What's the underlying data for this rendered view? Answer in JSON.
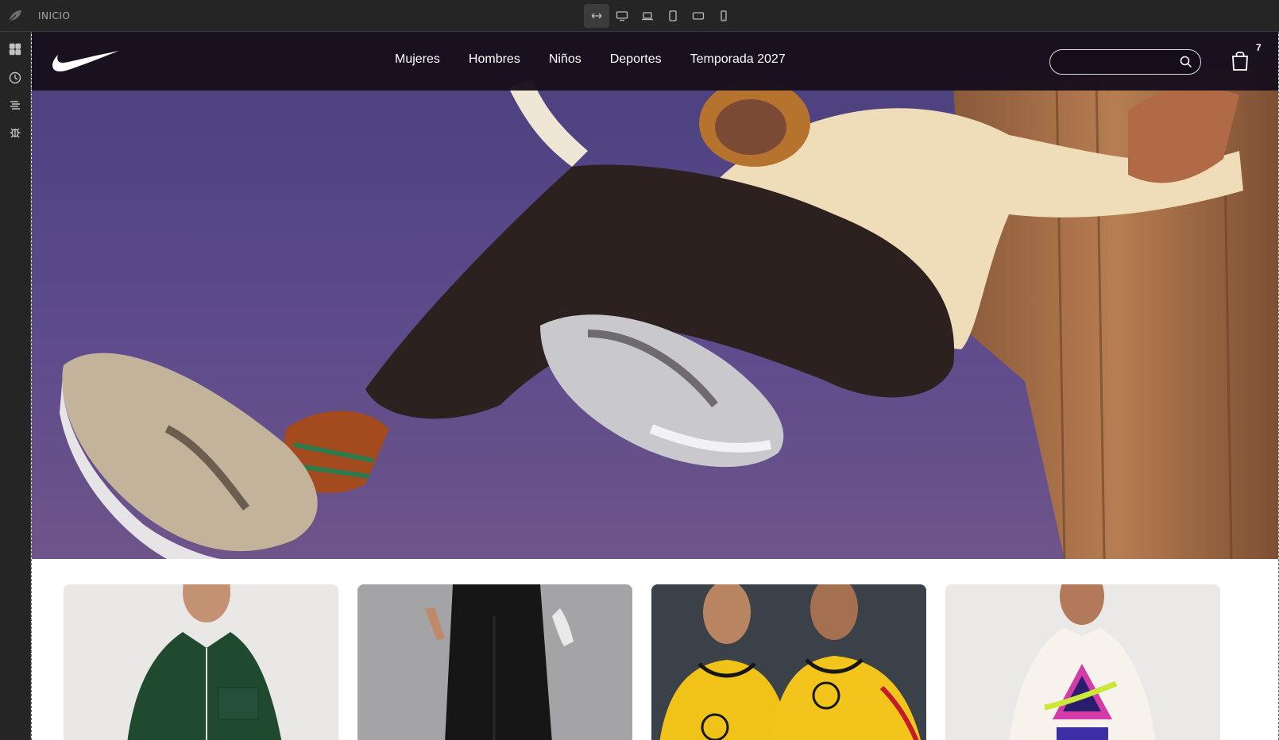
{
  "editor": {
    "breadcrumb": "INICIO",
    "devices": [
      "fit-width-icon",
      "desktop-icon",
      "laptop-icon",
      "tablet-icon",
      "tablet-landscape-icon",
      "mobile-icon"
    ],
    "sidebar": [
      "grid-icon",
      "history-icon",
      "layers-icon",
      "bug-icon"
    ]
  },
  "site": {
    "logo": "nike-swoosh-logo",
    "nav": [
      "Mujeres",
      "Hombres",
      "Niños",
      "Deportes",
      "Temporada 2027"
    ],
    "search": {
      "value": "",
      "placeholder": ""
    },
    "cart_count": "7"
  },
  "hero": {
    "image": "sneaker-jump-photo"
  },
  "cards": [
    {
      "image": "woman-green-jacket-photo",
      "color": "#e9e8e6"
    },
    {
      "image": "black-pants-golf-glove-photo",
      "color": "#9b9b9d"
    },
    {
      "image": "yellow-football-kits-photo",
      "color": "#3b4148"
    },
    {
      "image": "graphic-tee-photo",
      "color": "#ebe9e7"
    }
  ]
}
